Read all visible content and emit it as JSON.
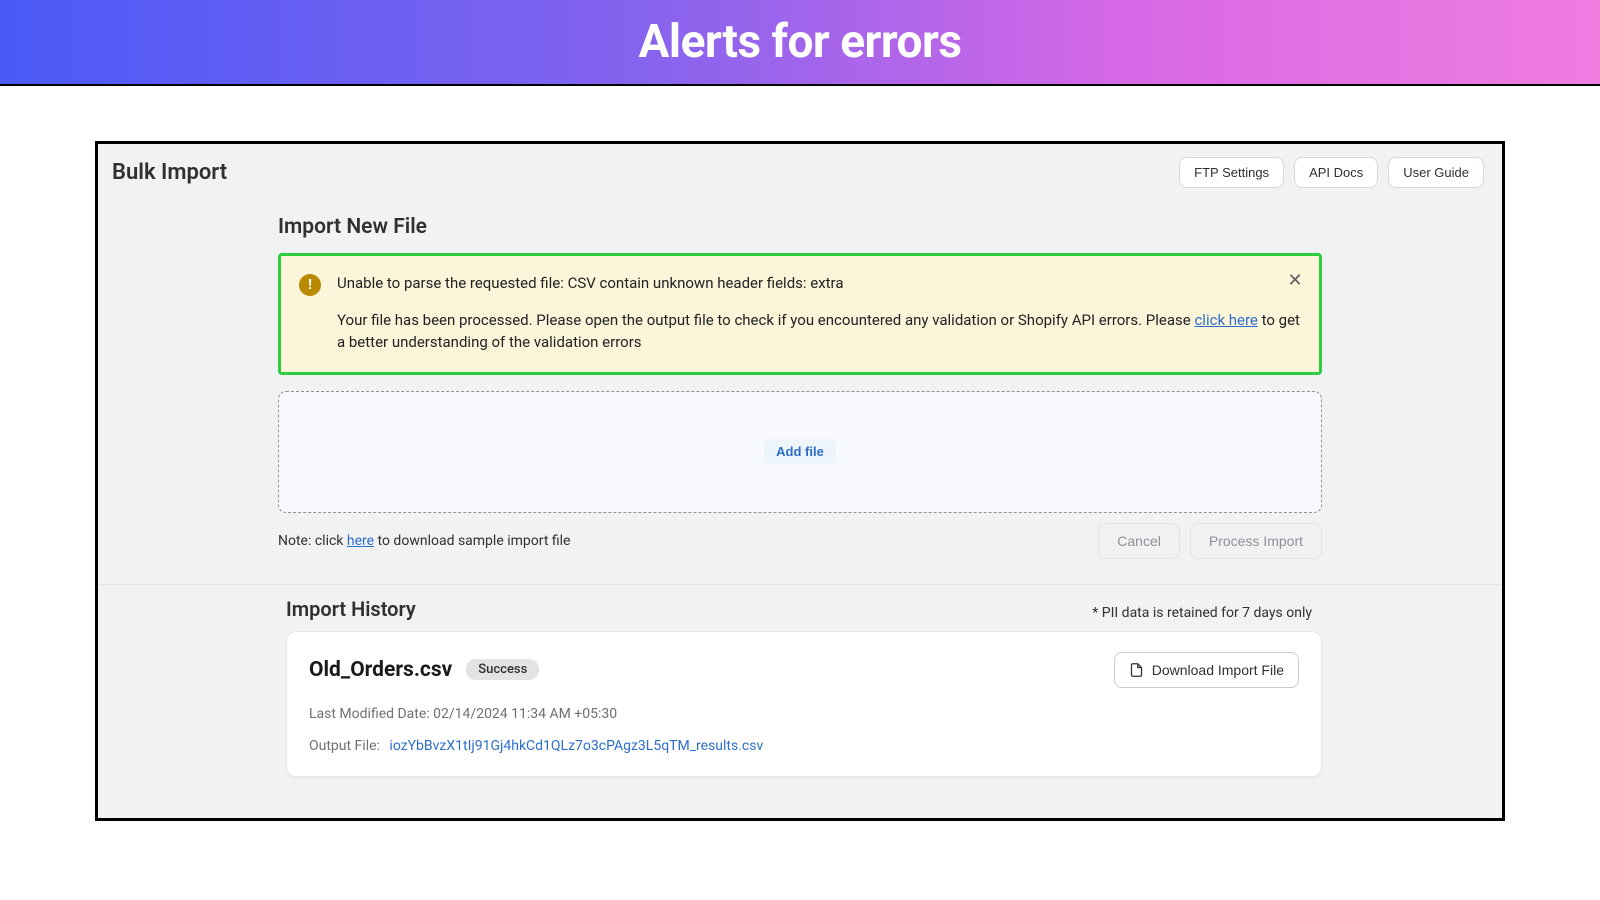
{
  "banner": {
    "title": "Alerts for errors"
  },
  "header": {
    "title": "Bulk Import",
    "buttons": {
      "ftp": "FTP Settings",
      "api": "API Docs",
      "guide": "User Guide"
    }
  },
  "importNew": {
    "title": "Import New File",
    "alert": {
      "line1": "Unable to parse the requested file: CSV contain unknown header fields: extra",
      "line2a": "Your file has been processed. Please open the output file to check if you encountered any validation or Shopify API errors. Please ",
      "link": "click here",
      "line2b": " to get a better understanding of the validation errors"
    },
    "addFile": "Add file",
    "notePrefix": "Note: click ",
    "noteLink": "here",
    "noteSuffix": " to download sample import file",
    "cancel": "Cancel",
    "process": "Process Import"
  },
  "history": {
    "title": "Import History",
    "pii": "* PII data is retained for 7 days only",
    "card": {
      "fileName": "Old_Orders.csv",
      "badge": "Success",
      "download": "Download Import File",
      "modifiedLabel": "Last Modified Date: ",
      "modifiedValue": "02/14/2024 11:34 AM +05:30",
      "outputLabel": "Output File:",
      "outputFile": "iozYbBvzX1tIj91Gj4hkCd1QLz7o3cPAgz3L5qTM_results.csv"
    }
  }
}
